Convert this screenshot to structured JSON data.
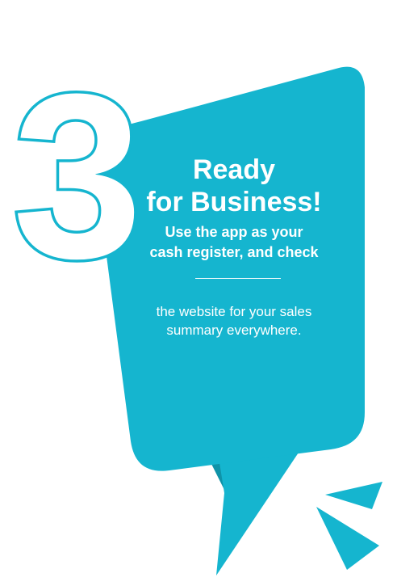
{
  "step_number": "3",
  "headline_line1": "Ready",
  "headline_line2": "for Business!",
  "subhead_line1": "Use the app as your",
  "subhead_line2": "cash register, and check",
  "body_line1": "the website for your sales",
  "body_line2": "summary everywhere.",
  "colors": {
    "bubble": "#15b5cf",
    "bubble_shadow": "#0f93a8",
    "outline": "#15b5cf",
    "text": "#ffffff"
  },
  "icons": [
    "speech-bubble-shape",
    "step-number-outline",
    "spark-accent-icon"
  ]
}
